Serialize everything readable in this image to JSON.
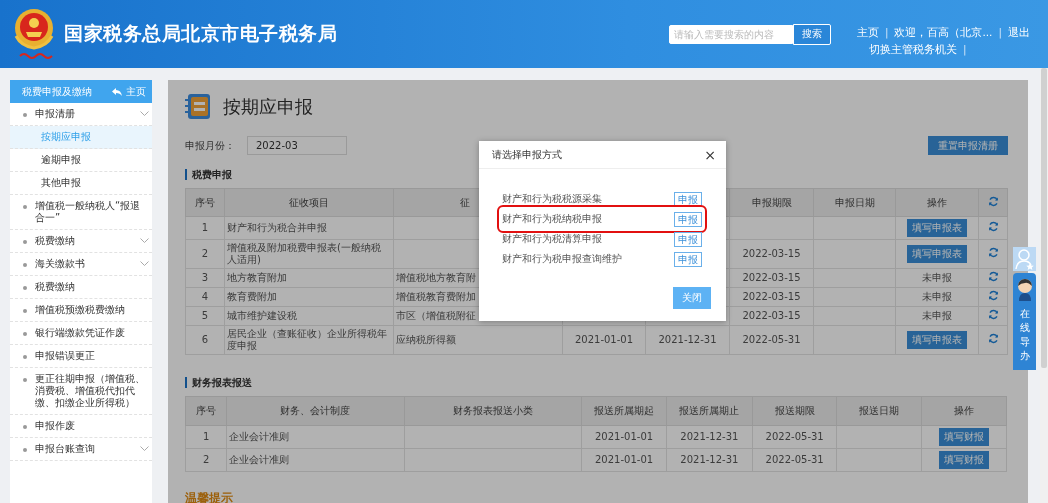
{
  "header": {
    "title": "国家税务总局北京市电子税务局",
    "search": {
      "placeholder": "请输入需要搜索的内容",
      "button": "搜索"
    },
    "nav_rows": [
      [
        {
          "kind": "link",
          "text": "主页"
        },
        {
          "kind": "separator",
          "text": "|"
        },
        {
          "kind": "link",
          "text": "欢迎，百高（北京..."
        },
        {
          "kind": "separator",
          "text": "|"
        },
        {
          "kind": "link",
          "text": "退出"
        }
      ],
      [
        {
          "kind": "link",
          "text": "切换主管税务机关"
        },
        {
          "kind": "separator",
          "text": "|"
        }
      ]
    ]
  },
  "sidebar": {
    "title": "税费申报及缴纳",
    "home": "主页",
    "items": [
      {
        "label": "申报清册",
        "expandable": true,
        "children": [
          {
            "label": "按期应申报",
            "selected": true
          },
          {
            "label": "逾期申报",
            "selected": false
          },
          {
            "label": "其他申报",
            "selected": false
          }
        ]
      },
      {
        "label": "增值税一般纳税人“报退合一”",
        "expandable": false
      },
      {
        "label": "税费缴纳",
        "expandable": true
      },
      {
        "label": "海关缴款书",
        "expandable": true
      },
      {
        "label": "税费缴纳",
        "expandable": false
      },
      {
        "label": "增值税预缴税费缴纳",
        "expandable": false
      },
      {
        "label": "银行端缴款凭证作废",
        "expandable": false
      },
      {
        "label": "申报错误更正",
        "expandable": false
      },
      {
        "label": "更正往期申报（增值税、消费税、增值税代扣代缴、扣缴企业所得税）",
        "expandable": false
      },
      {
        "label": "申报作废",
        "expandable": false
      },
      {
        "label": "申报台账查询",
        "expandable": true
      }
    ]
  },
  "main": {
    "page_title": "按期应申报",
    "month_label": "申报月份：",
    "month_value": "2022-03",
    "reset_button": "重置申报清册",
    "tax_section": {
      "title": "税费申报",
      "columns": [
        "序号",
        "征收项目",
        "征",
        null,
        null,
        "申报期限",
        "申报日期",
        "操作"
      ],
      "rows": [
        {
          "cells": [
            "1",
            "财产和行为税合并申报",
            null,
            null,
            null,
            null,
            null
          ],
          "action": {
            "kind": "button",
            "text": "填写申报表"
          }
        },
        {
          "cells": [
            "2",
            "增值税及附加税费申报表(一般纳税人适用)",
            null,
            null,
            null,
            "2022-03-15",
            null
          ],
          "action": {
            "kind": "button",
            "text": "填写申报表"
          }
        },
        {
          "cells": [
            "3",
            "地方教育附加",
            "增值税地方教育附",
            null,
            null,
            "2022-03-15",
            null
          ],
          "action": {
            "kind": "status",
            "text": "未申报"
          }
        },
        {
          "cells": [
            "4",
            "教育费附加",
            "增值税教育费附加",
            null,
            null,
            "2022-03-15",
            null
          ],
          "action": {
            "kind": "status",
            "text": "未申报"
          }
        },
        {
          "cells": [
            "5",
            "城市维护建设税",
            "市区（增值税附征",
            null,
            null,
            "2022-03-15",
            null
          ],
          "action": {
            "kind": "status",
            "text": "未申报"
          }
        },
        {
          "cells": [
            "6",
            "居民企业（查账征收）企业所得税年度申报",
            "应纳税所得额",
            "2021-01-01",
            "2021-12-31",
            "2022-05-31",
            null
          ],
          "action": {
            "kind": "button",
            "text": "填写申报表"
          }
        }
      ]
    },
    "finance_section": {
      "title": "财务报表报送",
      "columns": [
        "序号",
        "财务、会计制度",
        "财务报表报送小类",
        "报送所属期起",
        "报送所属期止",
        "报送期限",
        "报送日期",
        "操作"
      ],
      "rows": [
        {
          "cells": [
            "1",
            "企业会计准则",
            null,
            "2021-01-01",
            "2021-12-31",
            "2022-05-31",
            null
          ],
          "action": {
            "kind": "button",
            "text": "填写财报"
          }
        },
        {
          "cells": [
            "2",
            "企业会计准则",
            null,
            "2021-01-01",
            "2021-12-31",
            "2022-05-31",
            null
          ],
          "action": {
            "kind": "button",
            "text": "填写财报"
          }
        }
      ]
    },
    "tips_title": "温馨提示"
  },
  "modal": {
    "title": "请选择申报方式",
    "close_icon": "×",
    "options": [
      {
        "label": "财产和行为税税源采集",
        "button": "申报",
        "highlighted": false
      },
      {
        "label": "财产和行为税纳税申报",
        "button": "申报",
        "highlighted": true
      },
      {
        "label": "财产和行为税清算申报",
        "button": "申报",
        "highlighted": false
      },
      {
        "label": "财产和行为税申报查询维护",
        "button": "申报",
        "highlighted": false
      }
    ],
    "close_button": "关闭"
  },
  "assistant": {
    "label": "在线导办"
  }
}
